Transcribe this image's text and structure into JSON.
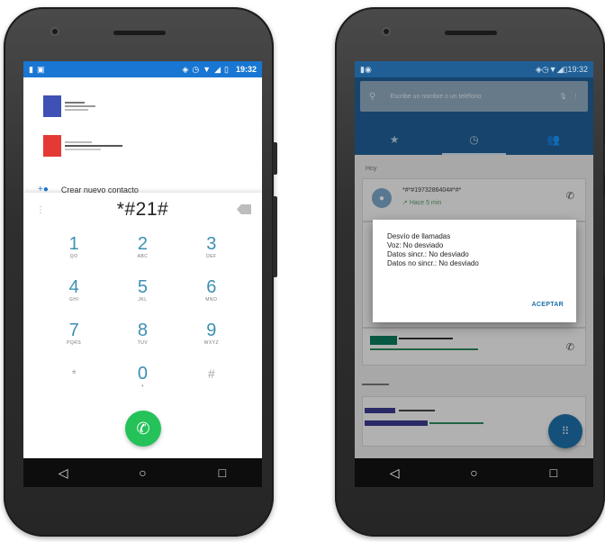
{
  "left_phone": {
    "status_time": "19:32",
    "new_contact_label": "Crear nuevo contacto",
    "dialed_number": "*#21#",
    "keys": [
      {
        "num": "1",
        "letters": "QO"
      },
      {
        "num": "2",
        "letters": "ABC"
      },
      {
        "num": "3",
        "letters": "DEF"
      },
      {
        "num": "4",
        "letters": "GHI"
      },
      {
        "num": "5",
        "letters": "JKL"
      },
      {
        "num": "6",
        "letters": "MNO"
      },
      {
        "num": "7",
        "letters": "PQRS"
      },
      {
        "num": "8",
        "letters": "TUV"
      },
      {
        "num": "9",
        "letters": "WXYZ"
      },
      {
        "num": "*",
        "letters": ""
      },
      {
        "num": "0",
        "letters": "+"
      },
      {
        "num": "#",
        "letters": ""
      }
    ],
    "contact_colors": [
      "#3f51b5",
      "#e53935"
    ],
    "call_button_color": "#25c25a"
  },
  "right_phone": {
    "status_time": "19:32",
    "search_placeholder": "Escribe un nombre o un teléfono",
    "section_today": "Hoy",
    "recent_number": "*#*#1973286404#*#*",
    "recent_time": "Hace 5 min",
    "dialog": {
      "title": "Desvío de llamadas",
      "line_voice": "Voz: No desviado",
      "line_sync": "Datos sincr.: No desviado",
      "line_nosync": "Datos no sincr.: No desviado",
      "accept": "ACEPTAR"
    },
    "accent": "#1f5f96"
  }
}
